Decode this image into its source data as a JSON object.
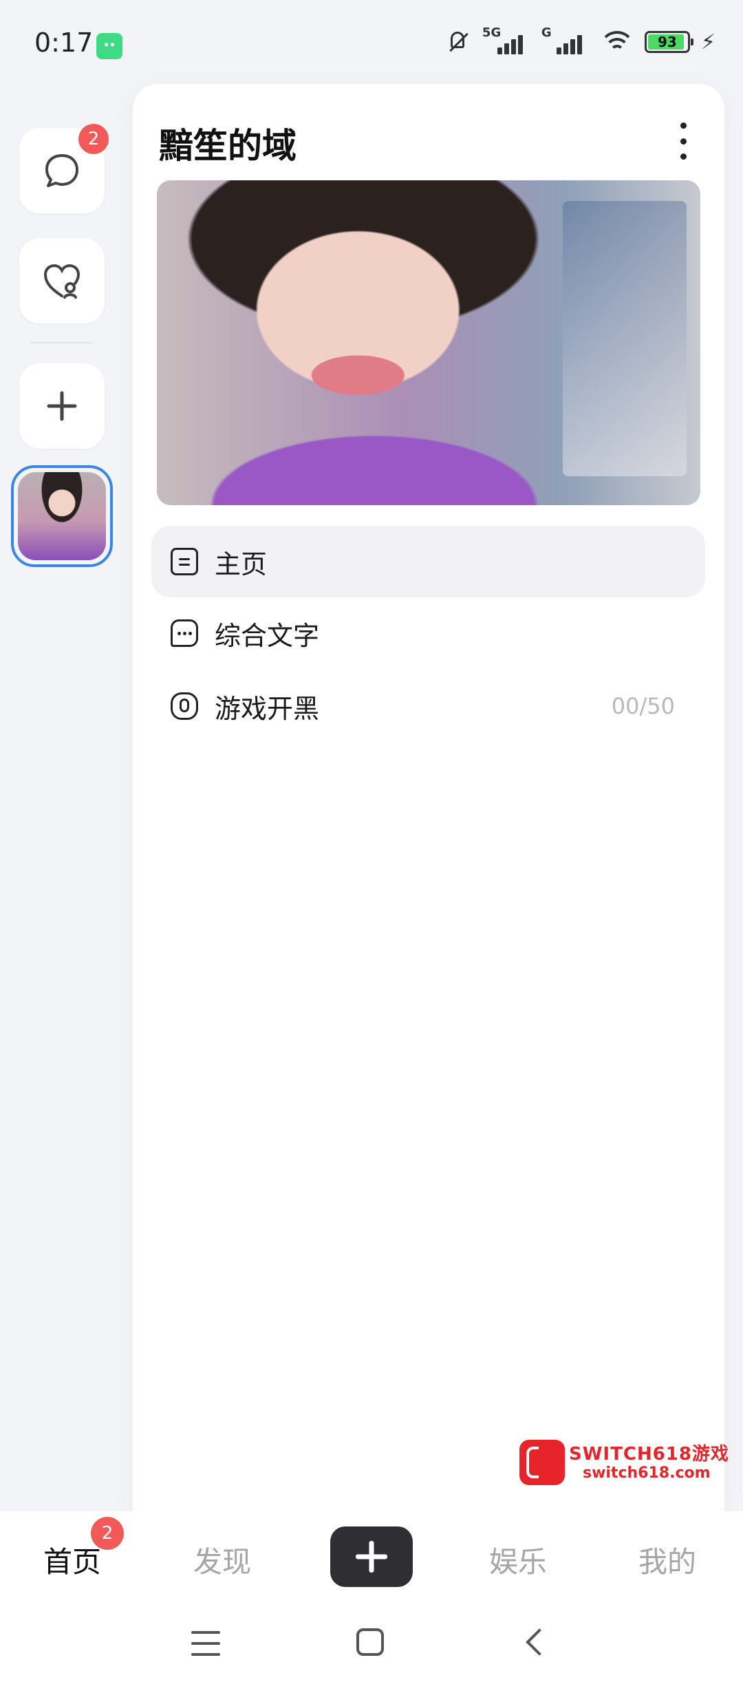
{
  "status_bar": {
    "time": "0:17",
    "signal1_tag": "5G",
    "signal2_tag": "G",
    "battery": "93"
  },
  "rail": {
    "messages_badge": "2"
  },
  "panel": {
    "title": "黯笙的域",
    "nav_items": [
      {
        "label": "主页",
        "icon": "document-icon"
      },
      {
        "label": "综合文字",
        "icon": "chat-bubble-icon"
      },
      {
        "label": "游戏开黑",
        "icon": "microphone-icon",
        "count": "00/50"
      }
    ]
  },
  "watermark": {
    "title": "SWITCH618游戏",
    "url": "switch618.com"
  },
  "tabbar": {
    "home": "首页",
    "home_badge": "2",
    "discover": "发现",
    "entertainment": "娱乐",
    "mine": "我的"
  },
  "colors": {
    "accent": "#3a86e8",
    "badge": "#f25a5a",
    "add_button": "#2f2f33"
  }
}
